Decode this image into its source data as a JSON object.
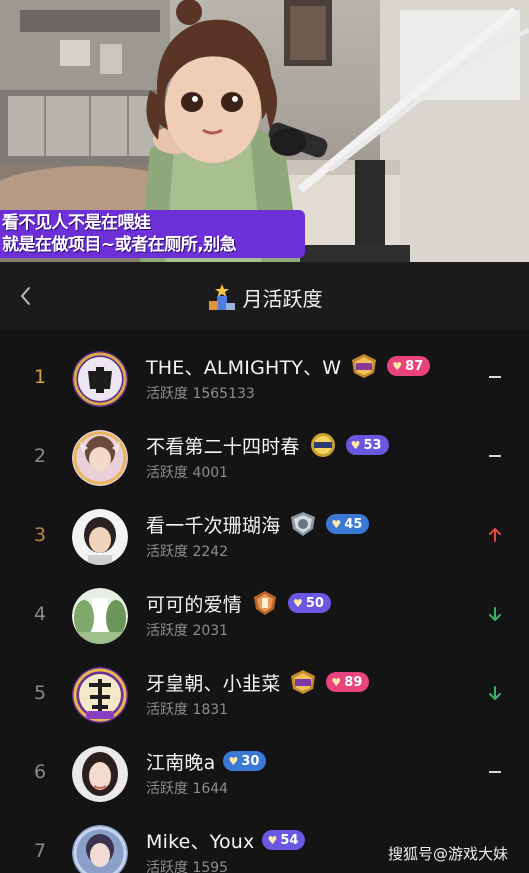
{
  "stream": {
    "caption_line1": "看不见人不是在喂娃",
    "caption_line2": "就是在做项目~或者在厕所,别急"
  },
  "header": {
    "back_icon": "chevron-left-icon",
    "title_icon": "podium-icon",
    "title": "月活跃度"
  },
  "rows": [
    {
      "rank": "1",
      "name": "THE、ALMIGHTY、W",
      "activity": "活跃度 1565133",
      "medal": "star-medal",
      "badge": "87",
      "badge_color": "#e8437c",
      "trend": "same"
    },
    {
      "rank": "2",
      "name": "不看第二十四时春",
      "activity": "活跃度 4001",
      "medal": "gold-medal",
      "badge": "53",
      "badge_color": "#6a57e2",
      "trend": "same"
    },
    {
      "rank": "3",
      "name": "看一千次珊瑚海",
      "activity": "活跃度 2242",
      "medal": "silver-shield-medal",
      "badge": "45",
      "badge_color": "#3a78d4",
      "trend": "up"
    },
    {
      "rank": "4",
      "name": "可可的爱情",
      "activity": "活跃度 2031",
      "medal": "bronze-medal",
      "badge": "50",
      "badge_color": "#6a57e2",
      "trend": "down"
    },
    {
      "rank": "5",
      "name": "牙皇朝、小韭菜",
      "activity": "活跃度 1831",
      "medal": "star-medal",
      "badge": "89",
      "badge_color": "#e8437c",
      "trend": "down"
    },
    {
      "rank": "6",
      "name": "江南晚a",
      "activity": "活跃度 1644",
      "medal": "",
      "badge": "30",
      "badge_color": "#3a78d4",
      "trend": "same"
    },
    {
      "rank": "7",
      "name": "Mike、Youx",
      "activity": "活跃度 1595",
      "medal": "",
      "badge": "54",
      "badge_color": "#6a57e2",
      "trend": "same"
    }
  ],
  "watermark": "搜狐号@游戏大妹",
  "colors": {
    "background": "#141414",
    "header": "#1b1b1b",
    "caption": "#6c2fd8",
    "rank_gold": "#d6a23c",
    "trend_up": "#e0473f",
    "trend_down": "#3fae6a"
  }
}
